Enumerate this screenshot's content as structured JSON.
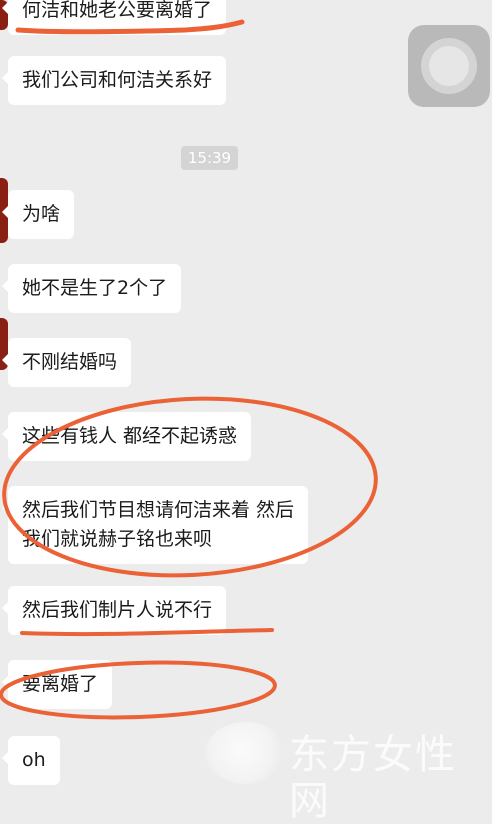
{
  "chat": {
    "timestamp": "15:39",
    "messages": [
      {
        "text": "何洁和她老公要离婚了"
      },
      {
        "text": "我们公司和何洁关系好"
      },
      {
        "text": "为啥"
      },
      {
        "text": "她不是生了2个了"
      },
      {
        "text": "不刚结婚吗"
      },
      {
        "text": "这些有钱人 都经不起诱惑"
      },
      {
        "text": "然后我们节目想请何洁来着 然后\n我们就说赫子铭也来呗"
      },
      {
        "text": "然后我们制片人说不行"
      },
      {
        "text": "要离婚了"
      },
      {
        "text": "oh"
      }
    ]
  },
  "watermark": {
    "text": "东方女性网"
  },
  "colors": {
    "annotation": "#ea6236",
    "bubble": "#ffffff",
    "background": "#ececec"
  }
}
